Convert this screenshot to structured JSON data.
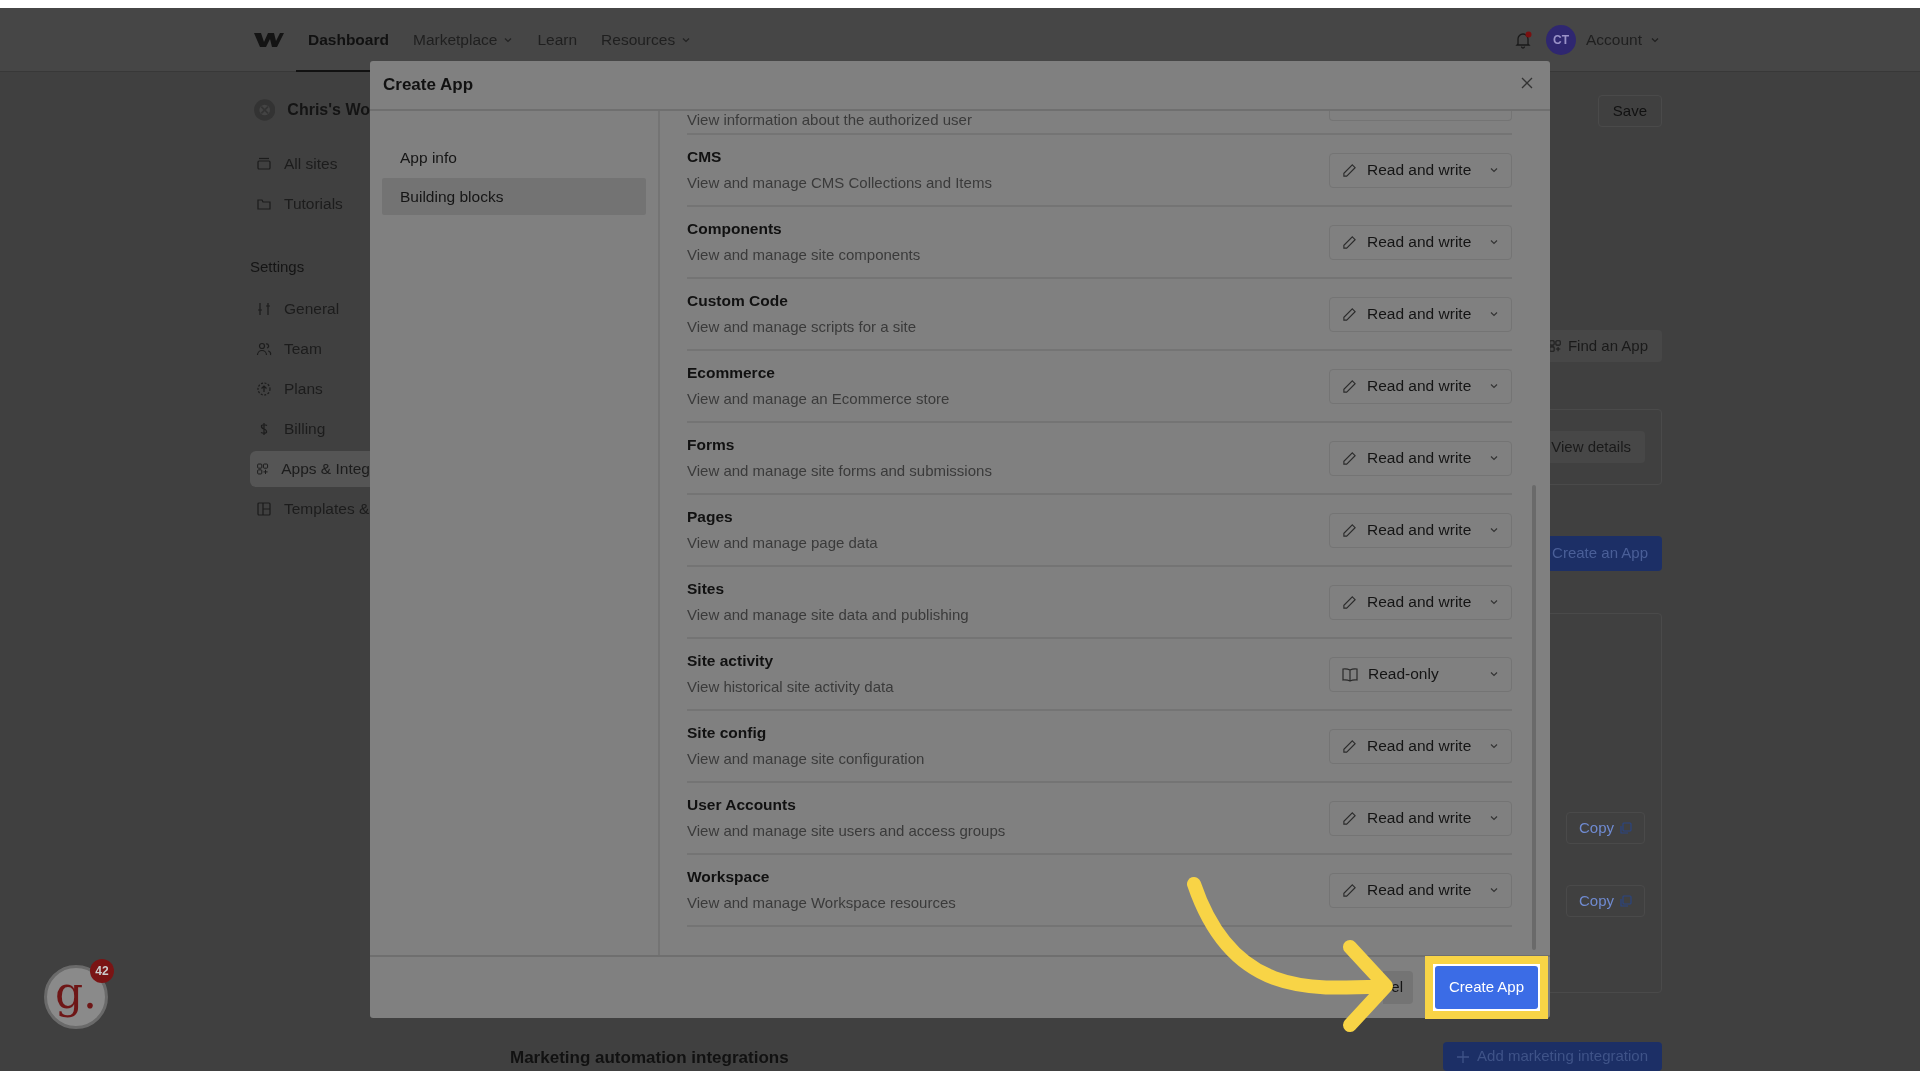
{
  "top_nav": {
    "items": [
      {
        "label": "Dashboard",
        "selected": true,
        "has_menu": false
      },
      {
        "label": "Marketplace",
        "selected": false,
        "has_menu": true
      },
      {
        "label": "Learn",
        "selected": false,
        "has_menu": false
      },
      {
        "label": "Resources",
        "selected": false,
        "has_menu": true
      }
    ],
    "notifications": {
      "unread": true
    },
    "account": {
      "initials": "CT",
      "label": "Account"
    }
  },
  "sidebar": {
    "workspace": "Chris's Wo",
    "items": [
      {
        "label": "All sites",
        "selected": false
      },
      {
        "label": "Tutorials",
        "selected": false
      }
    ],
    "section": "Settings",
    "settings_items": [
      {
        "label": "General",
        "selected": false
      },
      {
        "label": "Team",
        "selected": false
      },
      {
        "label": "Plans",
        "selected": false
      },
      {
        "label": "Billing",
        "selected": false
      },
      {
        "label": "Apps & Integ",
        "selected": true
      },
      {
        "label": "Templates &",
        "selected": false
      }
    ]
  },
  "background_page": {
    "save": "Save",
    "find_app": "Find an App",
    "view_details": "View details",
    "create_an_app": "Create an App",
    "copy_buttons": [
      "Copy",
      "Copy"
    ],
    "section_title": "Marketing automation integrations",
    "add_integration": "Add marketing integration"
  },
  "modal": {
    "title": "Create App",
    "nav": [
      {
        "label": "App info",
        "selected": false
      },
      {
        "label": "Building blocks",
        "selected": true
      }
    ],
    "permissions": [
      {
        "description": "View information about the authorized user"
      },
      {
        "title": "CMS",
        "description": "View and manage CMS Collections and Items",
        "access": {
          "kind": "read_write",
          "label": "Read and write"
        }
      },
      {
        "title": "Components",
        "description": "View and manage site components",
        "access": {
          "kind": "read_write",
          "label": "Read and write"
        }
      },
      {
        "title": "Custom Code",
        "description": "View and manage scripts for a site",
        "access": {
          "kind": "read_write",
          "label": "Read and write"
        }
      },
      {
        "title": "Ecommerce",
        "description": "View and manage an Ecommerce store",
        "access": {
          "kind": "read_write",
          "label": "Read and write"
        }
      },
      {
        "title": "Forms",
        "description": "View and manage site forms and submissions",
        "access": {
          "kind": "read_write",
          "label": "Read and write"
        }
      },
      {
        "title": "Pages",
        "description": "View and manage page data",
        "access": {
          "kind": "read_write",
          "label": "Read and write"
        }
      },
      {
        "title": "Sites",
        "description": "View and manage site data and publishing",
        "access": {
          "kind": "read_write",
          "label": "Read and write"
        }
      },
      {
        "title": "Site activity",
        "description": "View historical site activity data",
        "access": {
          "kind": "read_only",
          "label": "Read-only"
        }
      },
      {
        "title": "Site config",
        "description": "View and manage site configuration",
        "access": {
          "kind": "read_write",
          "label": "Read and write"
        }
      },
      {
        "title": "User Accounts",
        "description": "View and manage site users and access groups",
        "access": {
          "kind": "read_write",
          "label": "Read and write"
        }
      },
      {
        "title": "Workspace",
        "description": "View and manage Workspace resources",
        "access": {
          "kind": "read_write",
          "label": "Read and write"
        }
      }
    ],
    "footer": {
      "cancel": "el",
      "create": "Create App"
    }
  },
  "help_widget": {
    "label": "g.",
    "badge": "42"
  }
}
